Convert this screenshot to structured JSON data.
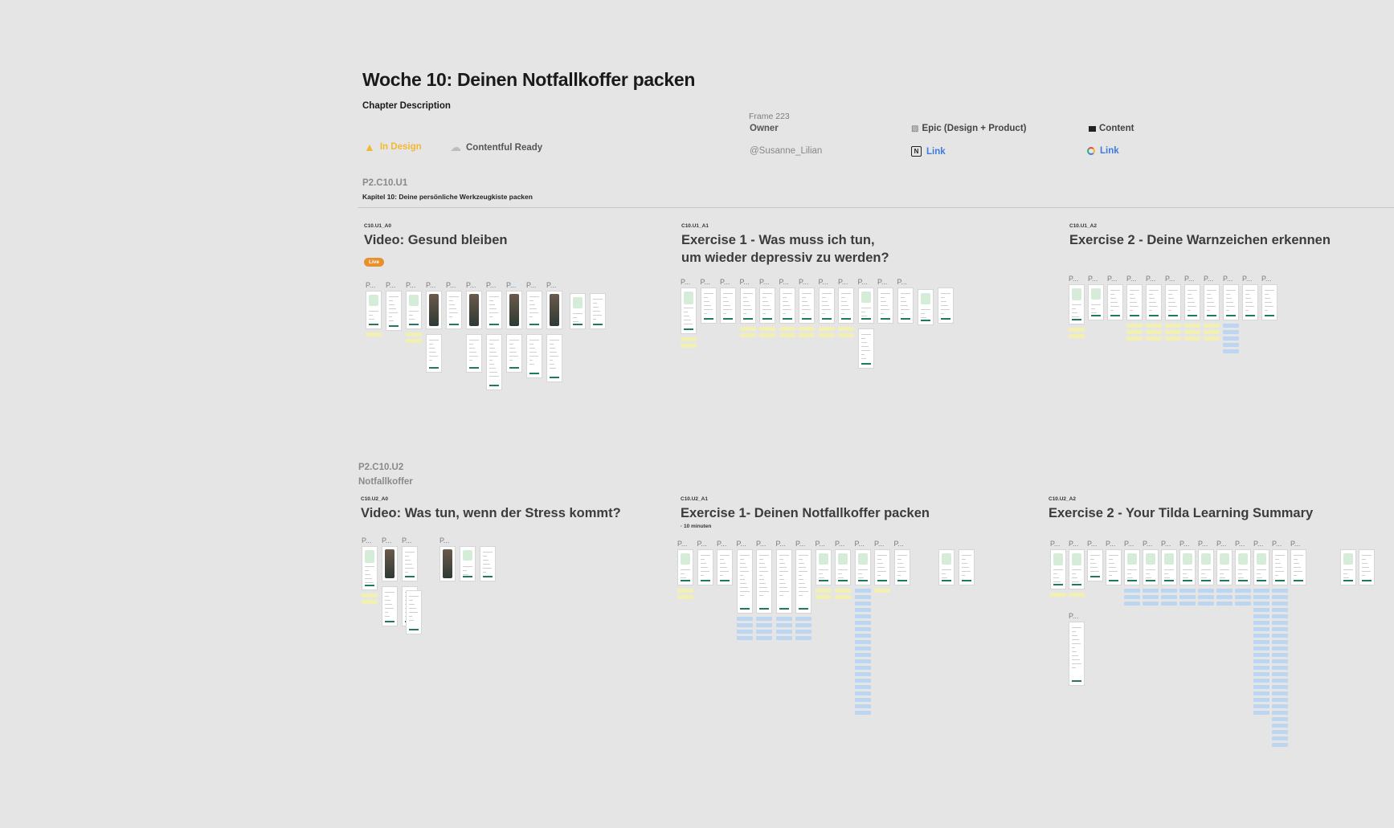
{
  "page": {
    "title": "Woche 10: Deinen Notfallkoffer packen",
    "chapter_description": "Chapter Description"
  },
  "status": {
    "in_design": {
      "label": "In Design",
      "icon": "ruler-icon",
      "color": "#f3b832"
    },
    "contentful": {
      "label": "Contentful Ready",
      "icon": "cloud-icon"
    }
  },
  "meta": {
    "frame_label": "Frame 223",
    "owner_label": "Owner",
    "owner_value": "@Susanne_Lilian",
    "epic_label": "Epic (Design + Product)",
    "epic_link": "Link",
    "content_label": "Content",
    "content_link": "Link"
  },
  "sections": [
    {
      "code": "P2.C10.U1",
      "subtitle": "Kapitel 10: Deine persönliche Werkzeugkiste packen",
      "name": "",
      "frames": [
        {
          "code": "C10.U1_A0",
          "title": "Video: Gesund bleiben",
          "badge": "Live"
        },
        {
          "code": "C10.U1_A1",
          "title_line1": "Exercise 1 - Was muss ich tun,",
          "title_line2": "um wieder depressiv zu werden?"
        },
        {
          "code": "C10.U1_A2",
          "title": "Exercise 2 - Deine Warnzeichen erkennen"
        }
      ]
    },
    {
      "code": "P2.C10.U2",
      "name": "Notfallkoffer",
      "frames": [
        {
          "code": "C10.U2_A0",
          "title": "Video: Was tun, wenn der Stress kommt?"
        },
        {
          "code": "C10.U2_A1",
          "title": "Exercise 1- Deinen Notfallkoffer packen",
          "minutes": "10 minuten"
        },
        {
          "code": "C10.U2_A2",
          "title": "Exercise 2 - Your Tilda Learning Summary"
        }
      ]
    }
  ],
  "screen_label": "P...",
  "colors": {
    "accent_green": "#1f7a5c",
    "light_green": "#d5ecd9",
    "note_yellow": "#f1efb2",
    "note_blue": "#bcd6f1",
    "badge_orange": "#e8902c",
    "link_blue": "#3d7be0"
  }
}
